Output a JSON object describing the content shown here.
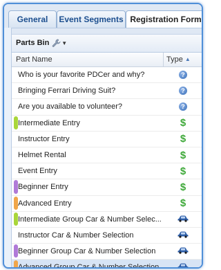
{
  "tabs": [
    {
      "label": "General"
    },
    {
      "label": "Event Segments"
    },
    {
      "label": "Registration Form"
    }
  ],
  "toolbar": {
    "title": "Parts Bin"
  },
  "table": {
    "columns": {
      "name": "Part Name",
      "type": "Type"
    },
    "rows": [
      {
        "name": "Who is your favorite PDCer and why?",
        "type": "question-icon",
        "highlight": ""
      },
      {
        "name": "Bringing Ferrari Driving Suit?",
        "type": "question-icon",
        "highlight": ""
      },
      {
        "name": "Are you available to volunteer?",
        "type": "question-icon",
        "highlight": ""
      },
      {
        "name": "Intermediate Entry",
        "type": "dollar-icon",
        "highlight": "green"
      },
      {
        "name": "Instructor Entry",
        "type": "dollar-icon",
        "highlight": ""
      },
      {
        "name": "Helmet Rental",
        "type": "dollar-icon",
        "highlight": ""
      },
      {
        "name": "Event Entry",
        "type": "dollar-icon",
        "highlight": ""
      },
      {
        "name": "Beginner Entry",
        "type": "dollar-icon",
        "highlight": "purple"
      },
      {
        "name": "Advanced Entry",
        "type": "dollar-icon",
        "highlight": "orange"
      },
      {
        "name": "Intermediate Group Car & Number Selec...",
        "type": "car-icon",
        "highlight": "green"
      },
      {
        "name": "Instructor Car & Number Selection",
        "type": "car-icon",
        "highlight": ""
      },
      {
        "name": "Beginner Group Car & Number Selection",
        "type": "car-icon",
        "highlight": "purple"
      },
      {
        "name": "Advanced Group Car & Number Selection",
        "type": "car-icon",
        "highlight": "orange",
        "selected": true
      }
    ]
  },
  "colors": {
    "green": "#a9d63a",
    "purple": "#b07ad8",
    "orange": "#f0a64a",
    "accent": "#4f8fd8"
  }
}
